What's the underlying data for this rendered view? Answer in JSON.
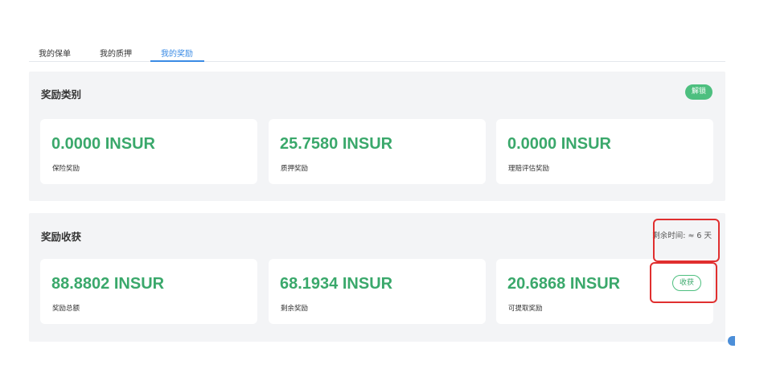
{
  "tabs": [
    {
      "label": "我的保单",
      "active": false
    },
    {
      "label": "我的质押",
      "active": false
    },
    {
      "label": "我的奖励",
      "active": true
    }
  ],
  "reward_types": {
    "title": "奖励类别",
    "unlock_label": "解锁",
    "cards": [
      {
        "value": "0.0000 INSUR",
        "label": "保险奖励"
      },
      {
        "value": "25.7580 INSUR",
        "label": "质押奖励"
      },
      {
        "value": "0.0000 INSUR",
        "label": "理赔评估奖励"
      }
    ]
  },
  "reward_harvest": {
    "title": "奖励收获",
    "remaining_time": "剩余时间: ≈ 6 天",
    "harvest_label": "收获",
    "cards": [
      {
        "value": "88.8802 INSUR",
        "label": "奖励总额"
      },
      {
        "value": "68.1934 INSUR",
        "label": "剩余奖励"
      },
      {
        "value": "20.6868 INSUR",
        "label": "可提取奖励"
      }
    ]
  },
  "colors": {
    "accent_green": "#3aa86b",
    "tab_active": "#3a8be5",
    "highlight_red": "#e02f2f"
  }
}
